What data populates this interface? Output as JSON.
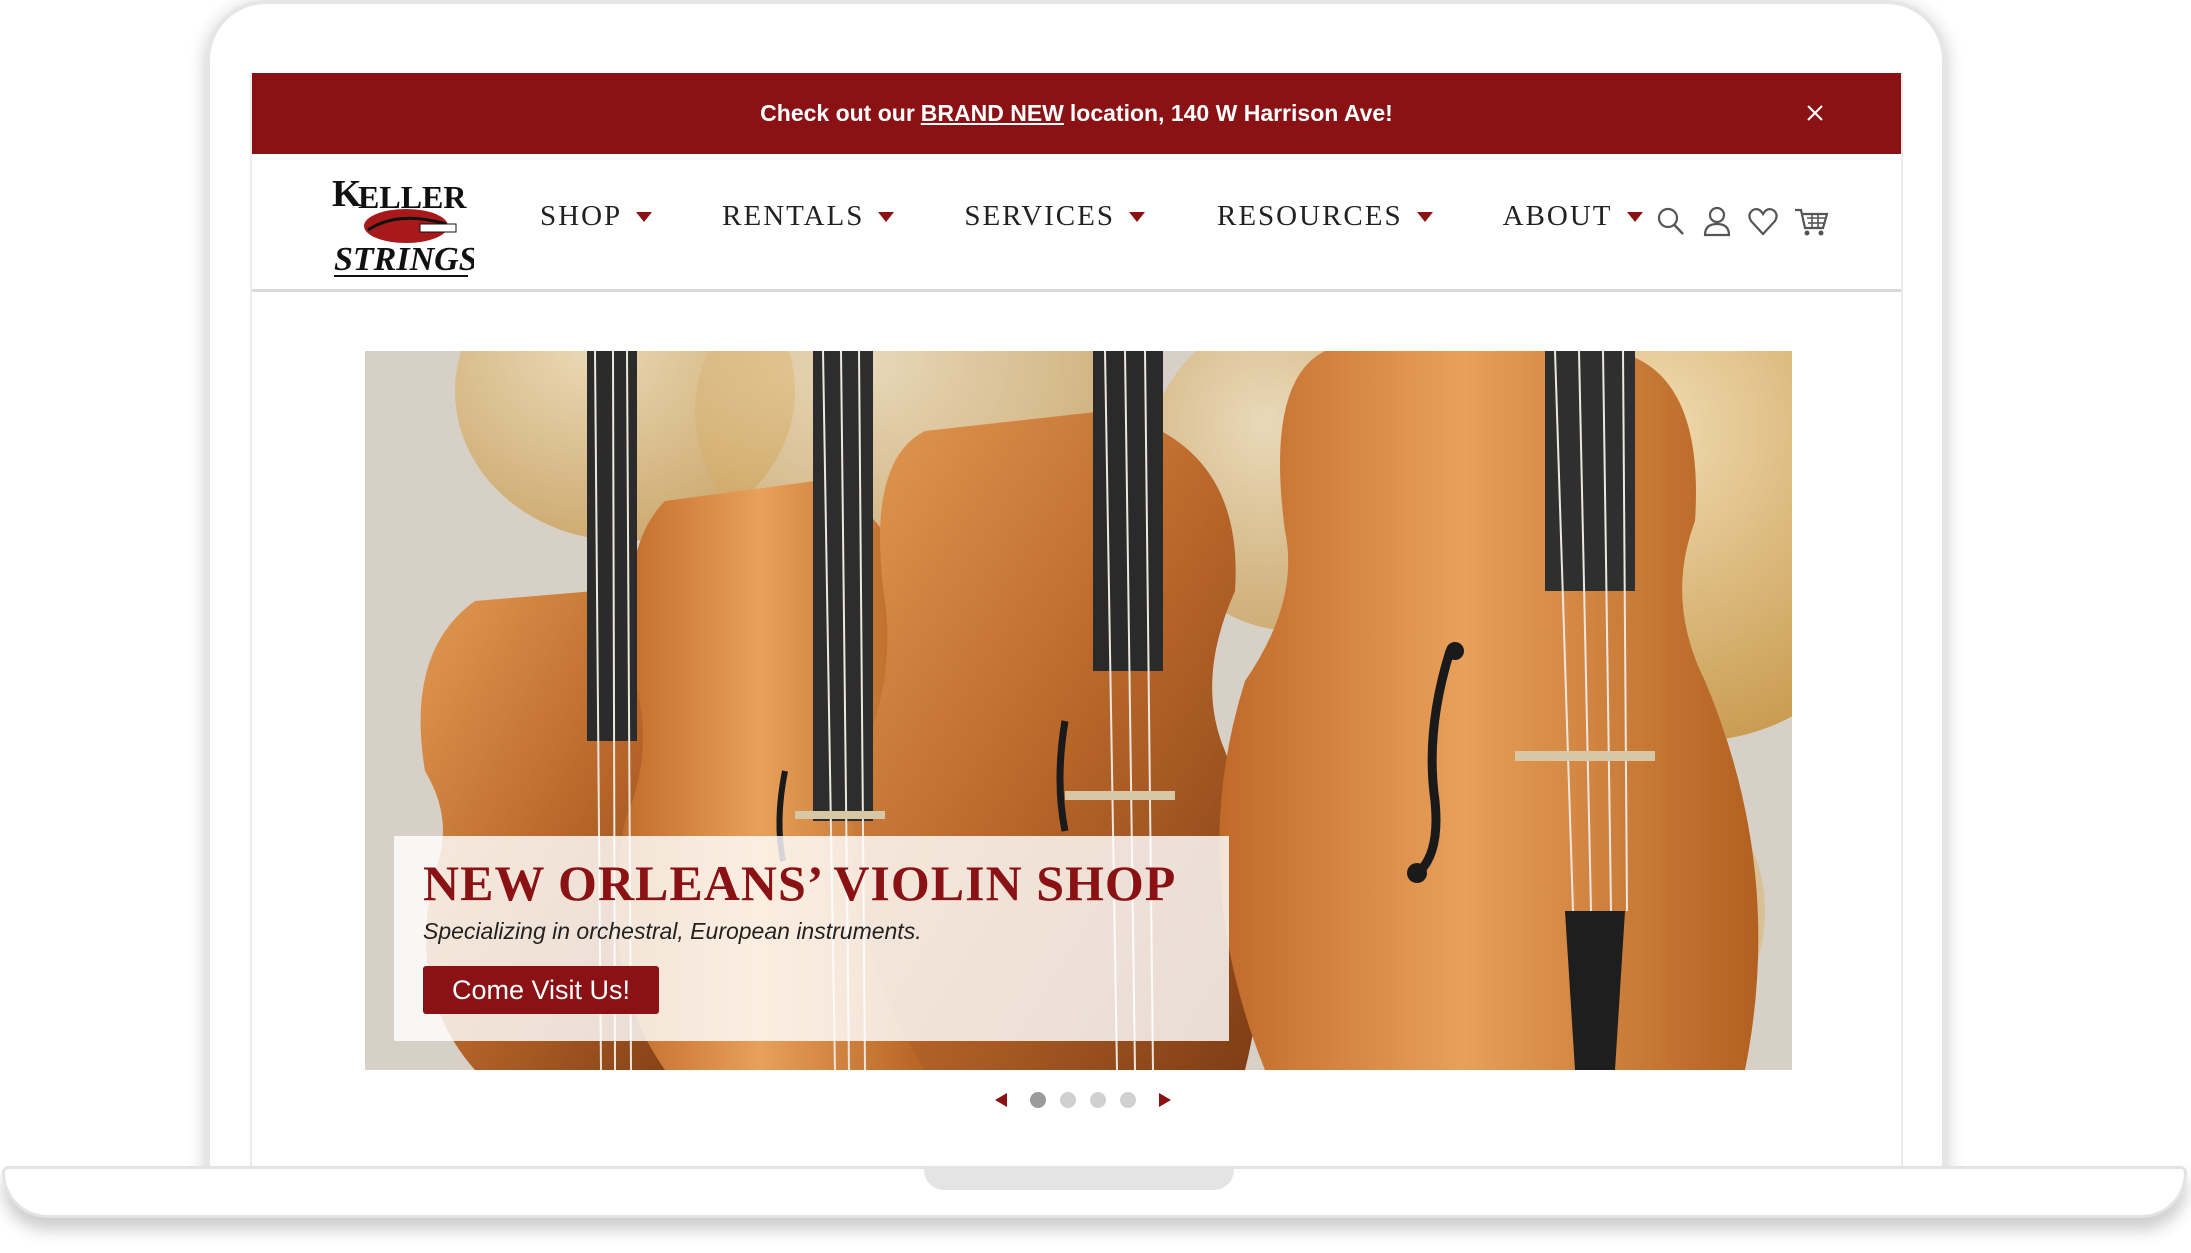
{
  "announcement": {
    "prefix": "Check out our",
    "link": "BRAND NEW",
    "suffix": "location, 140 W Harrison Ave!"
  },
  "header": {
    "logo_alt": "Keller Strings",
    "nav": [
      {
        "label": "SHOP"
      },
      {
        "label": "RENTALS"
      },
      {
        "label": "SERVICES"
      },
      {
        "label": "RESOURCES"
      },
      {
        "label": "ABOUT"
      }
    ],
    "icons": [
      "search-icon",
      "account-icon",
      "wishlist-heart-icon",
      "cart-icon"
    ]
  },
  "hero": {
    "title": "NEW ORLEANS’ VIOLIN SHOP",
    "subtitle": "Specializing in orchestral, European instruments.",
    "cta": "Come Visit Us!"
  },
  "slider": {
    "slide_count": 4,
    "active_index": 0
  },
  "colors": {
    "brand_red": "#8a1214",
    "text_dark": "#222222"
  }
}
